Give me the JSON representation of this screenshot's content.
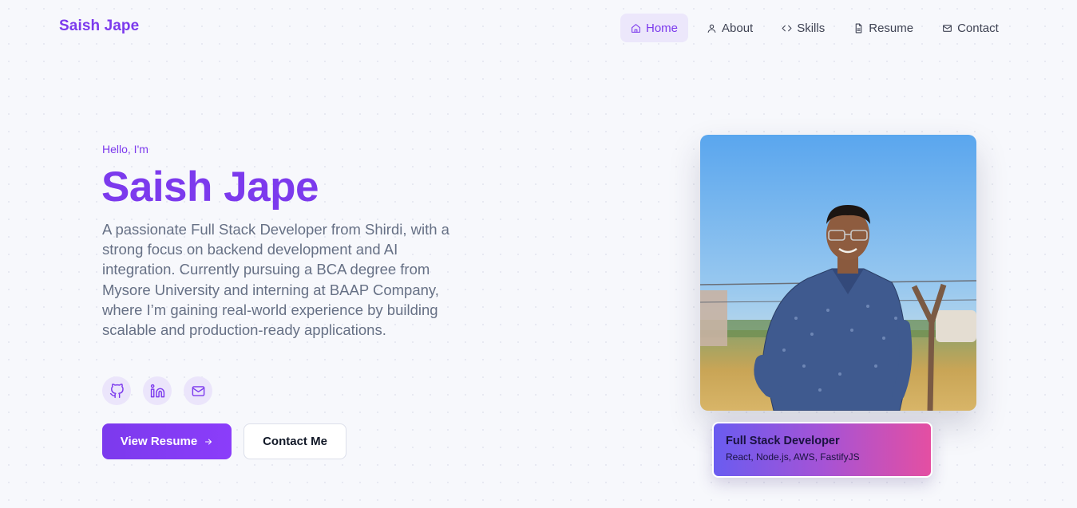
{
  "brand": "Saish Jape",
  "nav": {
    "items": [
      {
        "label": "Home",
        "icon": "home-icon",
        "active": true
      },
      {
        "label": "About",
        "icon": "user-icon",
        "active": false
      },
      {
        "label": "Skills",
        "icon": "code-icon",
        "active": false
      },
      {
        "label": "Resume",
        "icon": "file-icon",
        "active": false
      },
      {
        "label": "Contact",
        "icon": "mail-icon",
        "active": false
      }
    ]
  },
  "hero": {
    "greeting": "Hello, I'm",
    "name": "Saish Jape",
    "bio": "A passionate Full Stack Developer from Shirdi, with a strong focus on backend development and AI integration. Currently pursuing a BCA degree from Mysore University and interning at BAAP Company, where I’m gaining real-world experience by building scalable and production-ready applications.",
    "socials": [
      {
        "icon": "github-icon"
      },
      {
        "icon": "linkedin-icon"
      },
      {
        "icon": "mail-icon"
      }
    ],
    "primary_button": "View Resume",
    "secondary_button": "Contact Me"
  },
  "profile_card": {
    "title": "Full Stack Developer",
    "stack": "React, Node.js, AWS, FastifyJS"
  },
  "colors": {
    "accent": "#7c3aed",
    "accent_soft": "#ece7fb",
    "text_muted": "#667085",
    "background": "#f7f8fc",
    "card_gradient_start": "#6a5cf0",
    "card_gradient_end": "#e44fa2"
  }
}
